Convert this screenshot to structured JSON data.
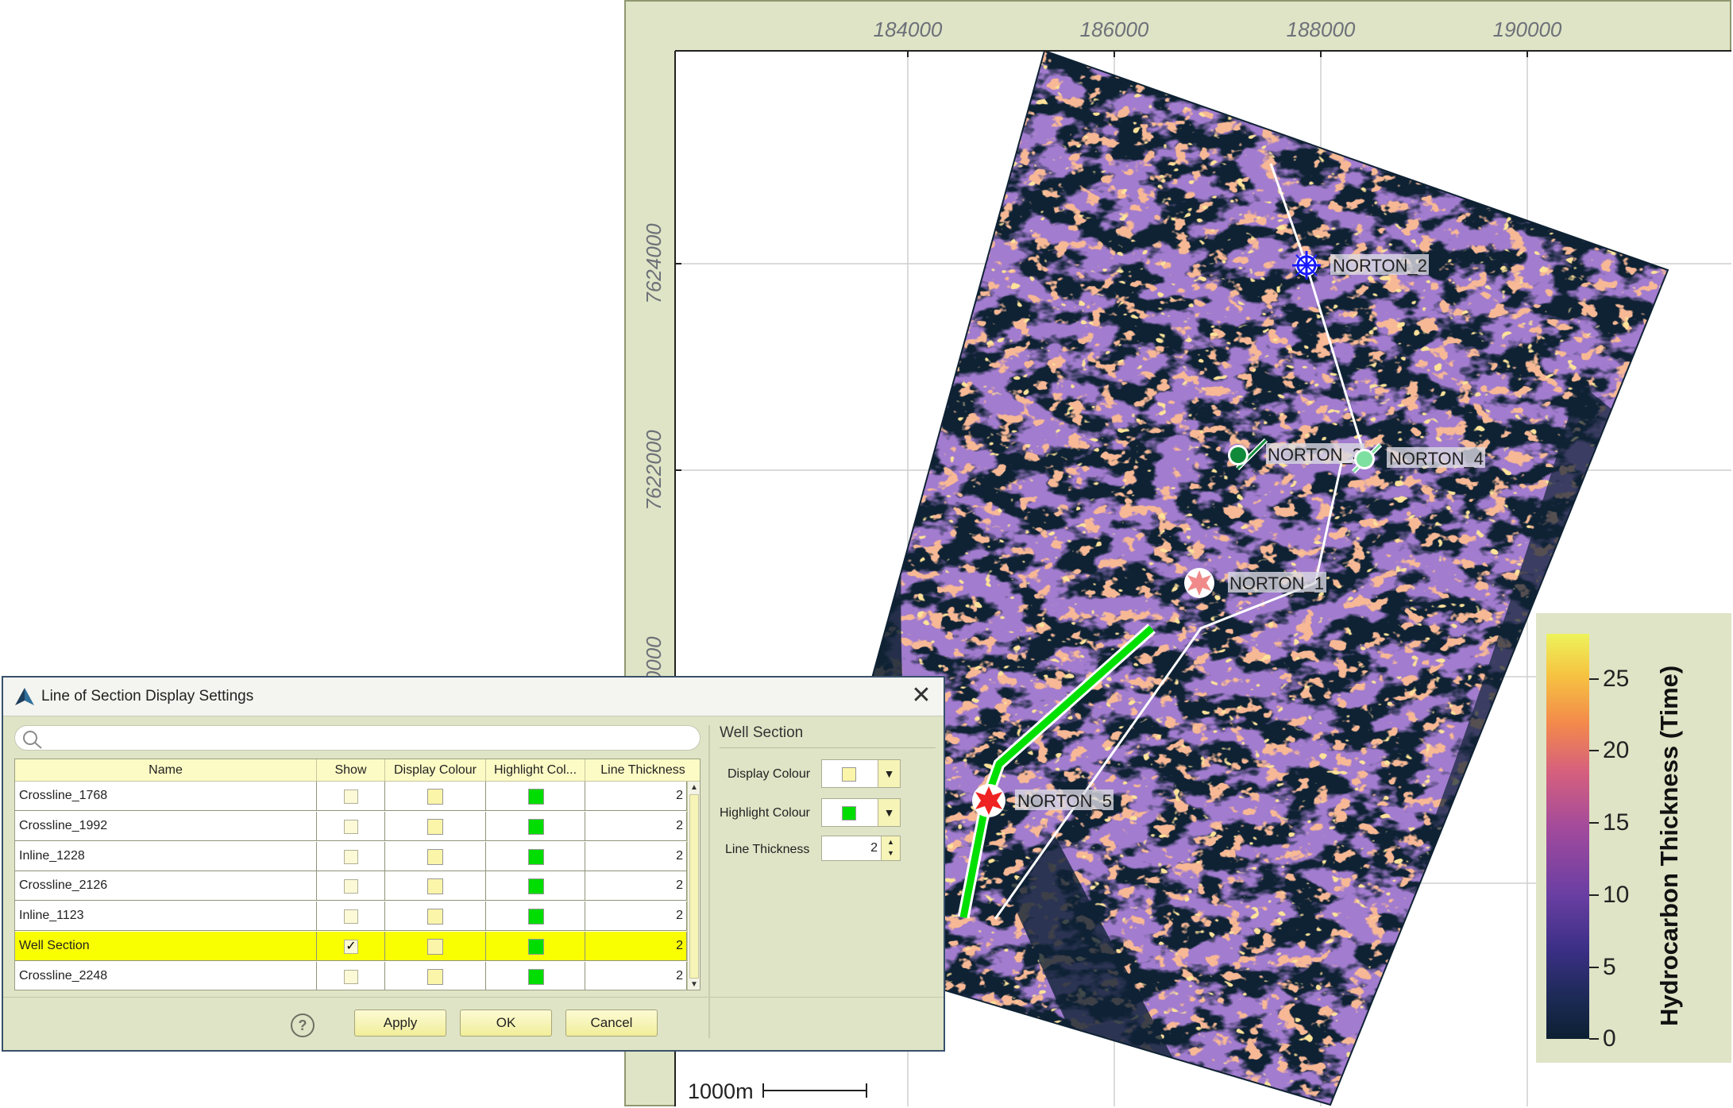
{
  "map": {
    "x_ticks": [
      "184000",
      "186000",
      "188000",
      "190000"
    ],
    "y_ticks": [
      "7624000",
      "7622000",
      "7620000"
    ],
    "scale_bar": "1000m",
    "wells": [
      {
        "name": "NORTON_2",
        "color": "#1a1aff"
      },
      {
        "name": "NORTON_3",
        "color": "#108a3a"
      },
      {
        "name": "NORTON_4",
        "color": "#7ee0a0"
      },
      {
        "name": "NORTON_1",
        "color": "#f08a8a"
      },
      {
        "name": "NORTON_5",
        "color": "#ee2222"
      }
    ],
    "section_line_color": "#ffffff",
    "highlight_color": "#00e000"
  },
  "legend": {
    "title": "Hydrocarbon Thickness (Time)",
    "ticks": [
      "25",
      "20",
      "15",
      "10",
      "5",
      "0"
    ]
  },
  "dialog": {
    "title": "Line of Section Display Settings",
    "close": "✕",
    "search_placeholder": "",
    "columns": [
      "Name",
      "Show",
      "Display Colour",
      "Highlight Col...",
      "Line Thickness"
    ],
    "rows": [
      {
        "name": "Crossline_1768",
        "show": "",
        "thickness": "2"
      },
      {
        "name": "Crossline_1992",
        "show": "",
        "thickness": "2"
      },
      {
        "name": "Inline_1228",
        "show": "",
        "thickness": "2"
      },
      {
        "name": "Crossline_2126",
        "show": "",
        "thickness": "2"
      },
      {
        "name": "Inline_1123",
        "show": "",
        "thickness": "2"
      },
      {
        "name": "Well Section",
        "show": "✓",
        "thickness": "2"
      },
      {
        "name": "Crossline_2248",
        "show": "",
        "thickness": "2"
      }
    ],
    "selected_row": "Well Section",
    "display_colour": "#fbf5a9",
    "highlight_colour": "#00dd00",
    "panel": {
      "title": "Well Section",
      "display_colour_label": "Display Colour",
      "highlight_colour_label": "Highlight Colour",
      "line_thickness_label": "Line Thickness",
      "line_thickness_value": "2"
    },
    "buttons": {
      "help": "?",
      "apply": "Apply",
      "ok": "OK",
      "cancel": "Cancel"
    }
  }
}
